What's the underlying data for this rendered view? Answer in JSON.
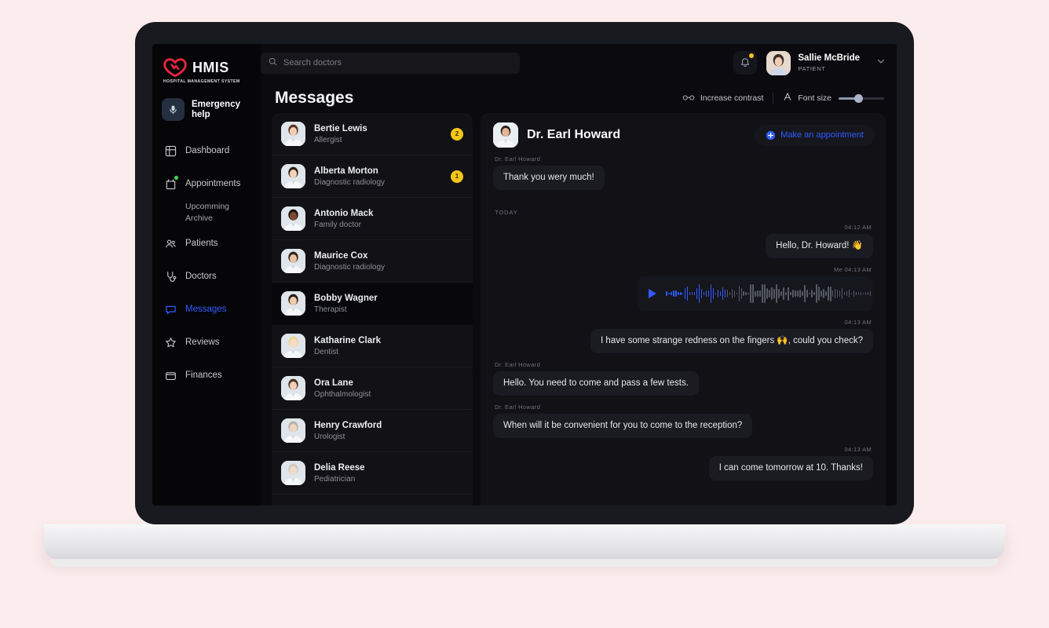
{
  "brand": {
    "name": "HMIS",
    "tagline": "HOSPITAL MANAGEMENT SYSTEM",
    "logo_icon": "heart-icon",
    "accent_color": "#e8253f"
  },
  "sidebar": {
    "emergency": {
      "label": "Emergency help",
      "icon": "microphone-icon"
    },
    "items": [
      {
        "label": "Dashboard",
        "icon": "grid-icon",
        "active": false,
        "dot": false
      },
      {
        "label": "Appointments",
        "icon": "calendar-plus-icon",
        "active": false,
        "dot": true
      },
      {
        "label": "Patients",
        "icon": "users-icon",
        "active": false,
        "dot": false
      },
      {
        "label": "Doctors",
        "icon": "stethoscope-icon",
        "active": false,
        "dot": false
      },
      {
        "label": "Messages",
        "icon": "chat-bubble-icon",
        "active": true,
        "dot": false
      },
      {
        "label": "Reviews",
        "icon": "star-icon",
        "active": false,
        "dot": false
      },
      {
        "label": "Finances",
        "icon": "wallet-icon",
        "active": false,
        "dot": false
      }
    ],
    "subnav": [
      {
        "label": "Upcomming"
      },
      {
        "label": "Archive"
      }
    ],
    "active_color": "#2f5cff"
  },
  "topbar": {
    "search": {
      "placeholder": "Search doctors",
      "value": "",
      "icon": "search-icon"
    },
    "notifications": {
      "icon": "bell-icon",
      "has_unread": true,
      "dot_color": "#f5c518"
    },
    "user": {
      "name": "Sallie McBride",
      "role": "PATIENT",
      "avatar": "user-avatar",
      "chevron": "chevron-down-icon"
    }
  },
  "page": {
    "title": "Messages",
    "accessibility": {
      "contrast": {
        "label": "Increase contrast",
        "icon": "glasses-icon"
      },
      "font_size": {
        "label": "Font size",
        "icon": "letter-a-icon",
        "value": 40
      }
    }
  },
  "conversations": [
    {
      "name": "Bertie Lewis",
      "specialty": "Allergist",
      "badge": "2",
      "selected": false
    },
    {
      "name": "Alberta Morton",
      "specialty": "Diagnostic radiology",
      "badge": "1",
      "selected": false
    },
    {
      "name": "Antonio Mack",
      "specialty": "Family doctor",
      "badge": null,
      "selected": false
    },
    {
      "name": "Maurice Cox",
      "specialty": "Diagnostic radiology",
      "badge": null,
      "selected": false
    },
    {
      "name": "Bobby Wagner",
      "specialty": "Therapist",
      "badge": null,
      "selected": true
    },
    {
      "name": "Katharine Clark",
      "specialty": "Dentist",
      "badge": null,
      "selected": false
    },
    {
      "name": "Ora Lane",
      "specialty": "Ophthalmologist",
      "badge": null,
      "selected": false
    },
    {
      "name": "Henry Crawford",
      "specialty": "Urologist",
      "badge": null,
      "selected": false
    },
    {
      "name": "Delia Reese",
      "specialty": "Pediatrician",
      "badge": null,
      "selected": false
    }
  ],
  "chat": {
    "doctor_name": "Dr. Earl Howard",
    "appointment_button": {
      "label": "Make an appointment",
      "icon": "plus-circle-icon"
    },
    "day_divider": "TODAY",
    "messages": [
      {
        "id": "m0",
        "side": "left",
        "meta": "Dr. Earl Howard",
        "type": "text",
        "text": "Thank you wery much!"
      },
      {
        "id": "m1",
        "side": "right",
        "meta": "04:12 AM",
        "type": "text",
        "text": "Hello, Dr. Howard! 👋"
      },
      {
        "id": "m2",
        "side": "right",
        "meta": "Me  04:13 AM",
        "type": "audio",
        "text": ""
      },
      {
        "id": "m3",
        "side": "right",
        "meta": "04:13 AM",
        "type": "text",
        "text": "I have some strange redness on the fingers 🙌, could you check?"
      },
      {
        "id": "m4",
        "side": "left",
        "meta": "Dr. Earl Howard",
        "type": "text",
        "text": "Hello. You need to come and pass a few tests."
      },
      {
        "id": "m5",
        "side": "left",
        "meta": "Dr. Earl Howard",
        "type": "text",
        "text": "When will it be convenient for you to come to the reception?"
      },
      {
        "id": "m6",
        "side": "right",
        "meta": "04:13 AM",
        "type": "text",
        "text": "I can come tomorrow at 10. Thanks!"
      }
    ]
  }
}
